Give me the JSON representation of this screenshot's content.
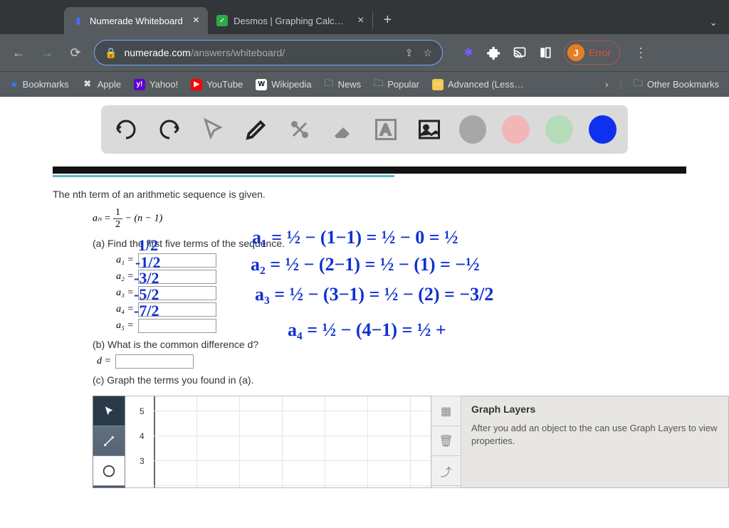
{
  "tabs": [
    {
      "title": "Numerade Whiteboard",
      "active": true
    },
    {
      "title": "Desmos | Graphing Calculato",
      "active": false
    }
  ],
  "url": {
    "domain": "numerade.com",
    "path": "/answers/whiteboard/"
  },
  "profile": {
    "initial": "J",
    "error": "Error"
  },
  "bookmarks": {
    "items": [
      "Bookmarks",
      "Apple",
      "Yahoo!",
      "YouTube",
      "Wikipedia",
      "News",
      "Popular",
      "Advanced (Less…"
    ],
    "other": "Other Bookmarks"
  },
  "colors": {
    "grey": "#a7a7a7",
    "pink": "#f3b6b6",
    "green": "#b4dcb8",
    "blue": "#1030f0"
  },
  "problem": {
    "intro": "The nth term of an arithmetic sequence is given.",
    "formula_lhs": "aₙ = ",
    "formula_frac_num": "1",
    "formula_frac_den": "2",
    "formula_rhs": " − (n − 1)",
    "part_a": "(a) Find the first five terms of the sequence.",
    "labels": [
      "a₁  =",
      "a₂  =",
      "a₃  =",
      "a₄  =",
      "a₅  ="
    ],
    "part_b": "(b) What is the common difference d?",
    "d_label": "d =",
    "part_c": "(c) Graph the terms you found in (a)."
  },
  "handwriting": {
    "a1": "1/2",
    "a2": "-1/2",
    "a3": "-3/2",
    "a4": "-5/2",
    "a5": "-7/2",
    "line1": "a₁ = ½ − (1−1) = ½ − 0 = ½",
    "line2": "a₂ = ½ − (2−1) = ½ − (1) = −½",
    "line3": "a₃ = ½ − (3−1) = ½ − (2) = −3/2",
    "line4": "a₄ = ½ − (4−1) = ½ +"
  },
  "graph": {
    "yticks": [
      "5",
      "4",
      "3"
    ],
    "layers_title": "Graph Layers",
    "layers_text": "After you add an object to the can use Graph Layers to view properties."
  }
}
